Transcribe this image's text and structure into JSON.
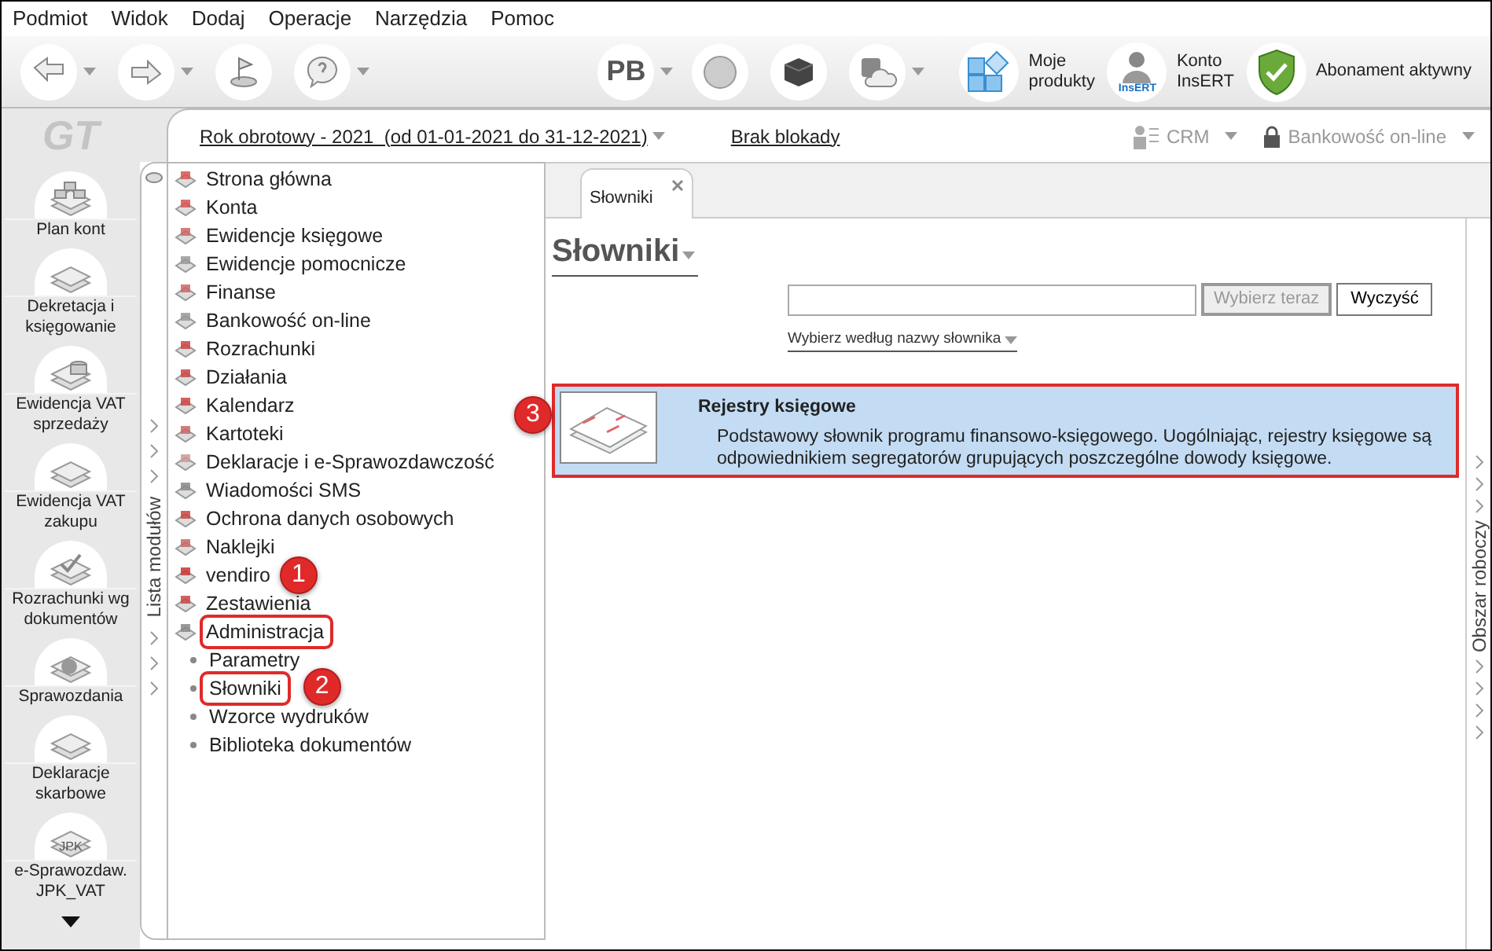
{
  "menu": [
    "Podmiot",
    "Widok",
    "Dodaj",
    "Operacje",
    "Narzędzia",
    "Pomoc"
  ],
  "toolbar": {
    "left": [
      {
        "kind": "arrow-left",
        "dropdown": true
      },
      {
        "kind": "arrow-right",
        "dropdown": true
      },
      {
        "kind": "flag",
        "dropdown": false
      },
      {
        "kind": "help",
        "dropdown": true
      }
    ],
    "badge": "PB",
    "right": [
      {
        "kind": "globe",
        "dropdown": false
      },
      {
        "kind": "cube",
        "dropdown": false
      },
      {
        "kind": "cloud",
        "dropdown": true
      }
    ],
    "links": [
      {
        "kind": "tiles",
        "label": "Moje\nprodukty"
      },
      {
        "kind": "person",
        "label": "Konto\nInsERT",
        "icon_text": "InsERT"
      },
      {
        "kind": "shield",
        "label": "Abonament aktywny"
      }
    ]
  },
  "logo": "GT",
  "sidebar": [
    {
      "kind": "plan",
      "label": "Plan kont"
    },
    {
      "kind": "clip",
      "label": "Dekretacja i księgowanie"
    },
    {
      "kind": "coins",
      "label": "Ewidencja VAT sprzedaży"
    },
    {
      "kind": "books",
      "label": "Ewidencja VAT zakupu"
    },
    {
      "kind": "check",
      "label": "Rozrachunki wg dokumentów"
    },
    {
      "kind": "pie",
      "label": "Sprawozdania"
    },
    {
      "kind": "papers",
      "label": "Deklaracje skarbowe"
    },
    {
      "kind": "jpk",
      "label": "e-Sprawozdaw. JPK_VAT",
      "icon_text": "JPK"
    }
  ],
  "header": {
    "fiscal_year": "Rok obrotowy - 2021  (od 01-01-2021 do 31-12-2021)",
    "lock": "Brak blokady",
    "crm": "CRM",
    "banking": "Bankowość on-line"
  },
  "modules": {
    "tab": "Lista modułów",
    "items": [
      {
        "label": "Strona główna",
        "highlighted": false
      },
      {
        "label": "Konta",
        "highlighted": false
      },
      {
        "label": "Ewidencje księgowe",
        "highlighted": false
      },
      {
        "label": "Ewidencje pomocnicze",
        "highlighted": false
      },
      {
        "label": "Finanse",
        "highlighted": false
      },
      {
        "label": "Bankowość on-line",
        "highlighted": false
      },
      {
        "label": "Rozrachunki",
        "highlighted": false
      },
      {
        "label": "Działania",
        "highlighted": false
      },
      {
        "label": "Kalendarz",
        "highlighted": false
      },
      {
        "label": "Kartoteki",
        "highlighted": false
      },
      {
        "label": "Deklaracje i e-Sprawozdawczość",
        "highlighted": false
      },
      {
        "label": "Wiadomości SMS",
        "highlighted": false
      },
      {
        "label": "Ochrona danych osobowych",
        "highlighted": false
      },
      {
        "label": "Naklejki",
        "highlighted": false
      },
      {
        "label": "vendiro",
        "highlighted": false,
        "step": "1"
      },
      {
        "label": "Zestawienia",
        "highlighted": false
      },
      {
        "label": "Administracja",
        "highlighted": true,
        "children": [
          {
            "label": "Parametry",
            "highlighted": false
          },
          {
            "label": "Słowniki",
            "highlighted": true,
            "step": "2"
          },
          {
            "label": "Wzorce wydruków",
            "highlighted": false
          },
          {
            "label": "Biblioteka dokumentów",
            "highlighted": false
          }
        ]
      }
    ]
  },
  "tabs": [
    {
      "label": "Słowniki",
      "selected": true
    }
  ],
  "page": {
    "title": "Słowniki",
    "select_button": {
      "label": "Wybierz teraz",
      "disabled": true
    },
    "clear_button": {
      "label": "Wyczyść",
      "disabled": false
    },
    "filter": "Wybierz według nazwy słownika",
    "entries": [
      {
        "title": "Rejestry księgowe",
        "description": "Podstawowy słownik programu finansowo-księgowego. Uogólniając, rejestry księgowe są odpowiednikiem segregatorów grupujących poszczególne dowody księgowe.",
        "selected": true,
        "highlighted": true,
        "step": "3"
      }
    ]
  },
  "workspace": "Obszar roboczy"
}
